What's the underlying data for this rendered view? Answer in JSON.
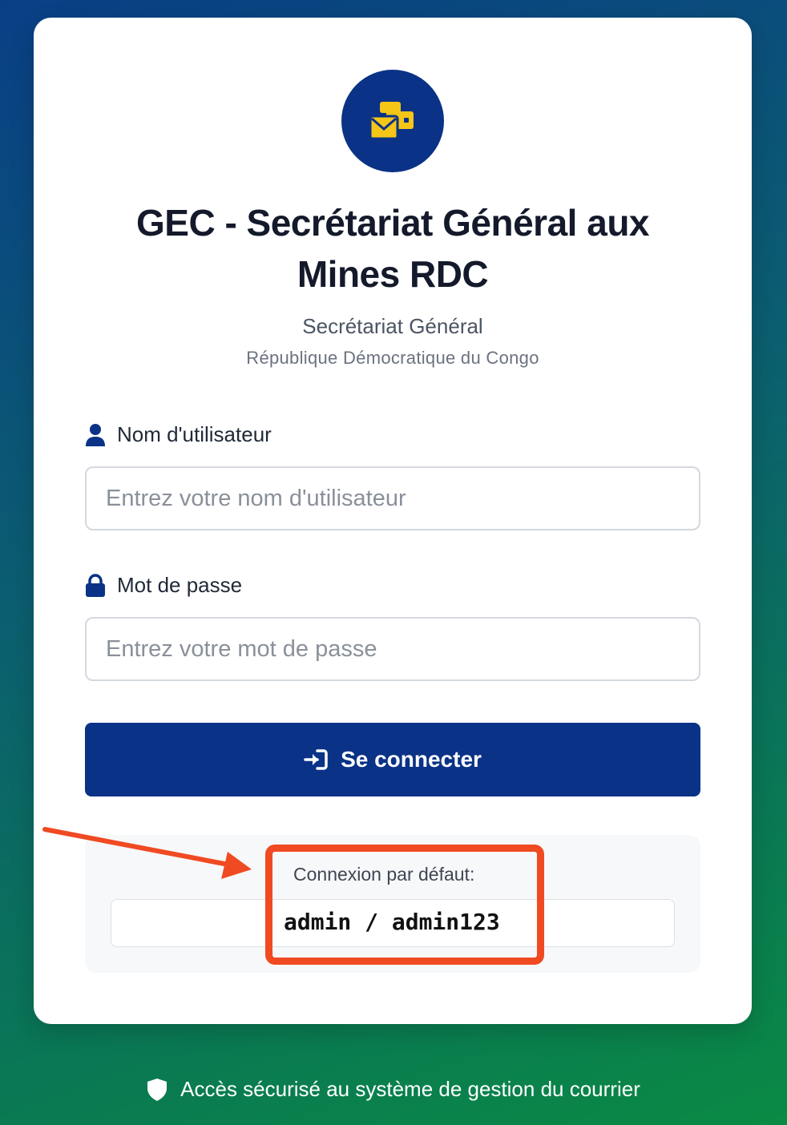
{
  "app": {
    "title": "GEC - Secrétariat Général aux Mines RDC",
    "subtitle": "Secrétariat Général",
    "subsubtitle": "République Démocratique du Congo"
  },
  "icons": {
    "logo": "envelopes-icon",
    "user": "user-icon",
    "password": "lock-icon",
    "login": "sign-in-icon",
    "footer": "shield-icon"
  },
  "form": {
    "username": {
      "label": "Nom d'utilisateur",
      "placeholder": "Entrez votre nom d'utilisateur",
      "value": ""
    },
    "password": {
      "label": "Mot de passe",
      "placeholder": "Entrez votre mot de passe",
      "value": ""
    },
    "submit_label": "Se connecter"
  },
  "default_login": {
    "label": "Connexion par défaut:",
    "credentials": "admin / admin123"
  },
  "footer": {
    "text": "Accès sécurisé au système de gestion du courrier"
  },
  "colors": {
    "primary": "#0a3286",
    "accent_yellow": "#f5c518",
    "annotation": "#f04a23",
    "gradient_start": "#0a3f86",
    "gradient_end": "#0a8a44"
  }
}
